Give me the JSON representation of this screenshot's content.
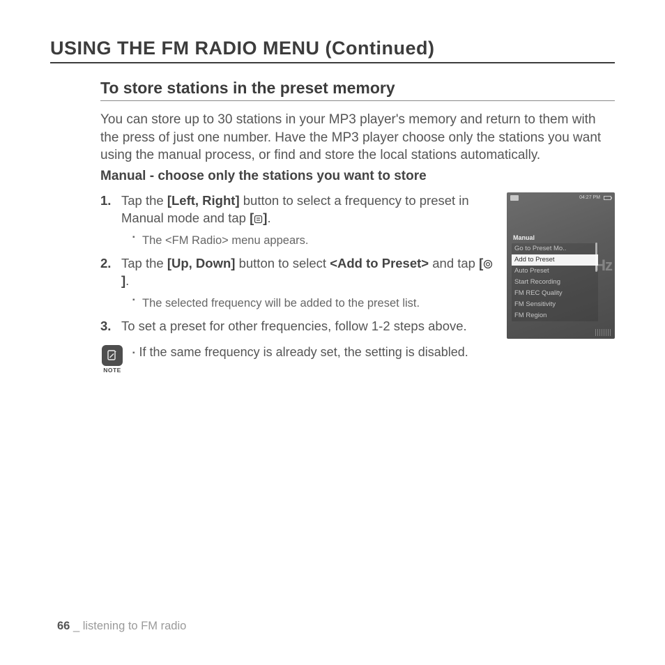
{
  "heading": "USING THE FM RADIO MENU (Continued)",
  "subheading": "To store stations in the preset memory",
  "intro": "You can store up to 30 stations in your MP3 player's memory and return to them with the press of just one number. Have the MP3 player choose only the stations you want using the manual process, or find and store the local stations automatically.",
  "manual_heading": "Manual - choose only the stations you want to store",
  "steps": {
    "s1": {
      "a": "Tap the ",
      "b": "[Left, Right]",
      "c": " button to select a frequency to preset in Manual mode and tap ",
      "d": "[",
      "e": "]",
      "f": ".",
      "sub": "The <FM Radio> menu appears."
    },
    "s2": {
      "a": "Tap the ",
      "b": "[Up, Down]",
      "c": " button to select ",
      "d": "<Add to Preset>",
      "e": " and tap ",
      "f": "[",
      "g": "]",
      "h": ".",
      "sub": "The selected frequency will be added to the preset list."
    },
    "s3": {
      "a": "To set a preset for other frequencies, follow 1-2 steps above."
    }
  },
  "note": {
    "label": "NOTE",
    "text": "If the same frequency is already set, the setting is disabled."
  },
  "device": {
    "time": "04:27 PM",
    "menu_title": "Manual",
    "bg_unit": "Hz",
    "items": [
      "Go to Preset Mo..",
      "Add to Preset",
      "Auto Preset",
      "Start Recording",
      "FM REC Quality",
      "FM Sensitivity",
      "FM Region"
    ],
    "selected_index": 1
  },
  "footer": {
    "page": "66",
    "sep": " _ ",
    "section": "listening to FM radio"
  }
}
